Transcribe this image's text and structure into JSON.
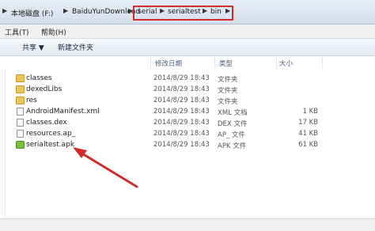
{
  "address": {
    "crumbs": [
      "本地磁盘 (F:)",
      "BaiduYunDownload",
      "serial",
      "serialtest",
      "bin"
    ]
  },
  "menu": {
    "tools": "工具(T)",
    "help": "帮助(H)"
  },
  "toolbar": {
    "share": "共享 ▼",
    "new_folder": "新建文件夹"
  },
  "columns": {
    "modified": "修改日期",
    "type": "类型",
    "size": "大小"
  },
  "files": [
    {
      "name": "classes",
      "date": "2014/8/29 18:43",
      "type": "文件夹",
      "size": "",
      "icon": "folder-icon"
    },
    {
      "name": "dexedLibs",
      "date": "2014/8/29 18:43",
      "type": "文件夹",
      "size": "",
      "icon": "folder-icon"
    },
    {
      "name": "res",
      "date": "2014/8/29 18:43",
      "type": "文件夹",
      "size": "",
      "icon": "folder-icon"
    },
    {
      "name": "AndroidManifest.xml",
      "date": "2014/8/29 18:43",
      "type": "XML 文档",
      "size": "1 KB",
      "icon": "xml-file-icon"
    },
    {
      "name": "classes.dex",
      "date": "2014/8/29 18:43",
      "type": "DEX 文件",
      "size": "17 KB",
      "icon": "file-icon"
    },
    {
      "name": "resources.ap_",
      "date": "2014/8/29 18:43",
      "type": "AP_ 文件",
      "size": "41 KB",
      "icon": "file-icon"
    },
    {
      "name": "serialtest.apk",
      "date": "2014/8/29 18:43",
      "type": "APK 文件",
      "size": "61 KB",
      "icon": "apk-file-icon"
    }
  ],
  "colors": {
    "highlight_box": "#d22b2b",
    "arrow": "#d22b2b"
  }
}
